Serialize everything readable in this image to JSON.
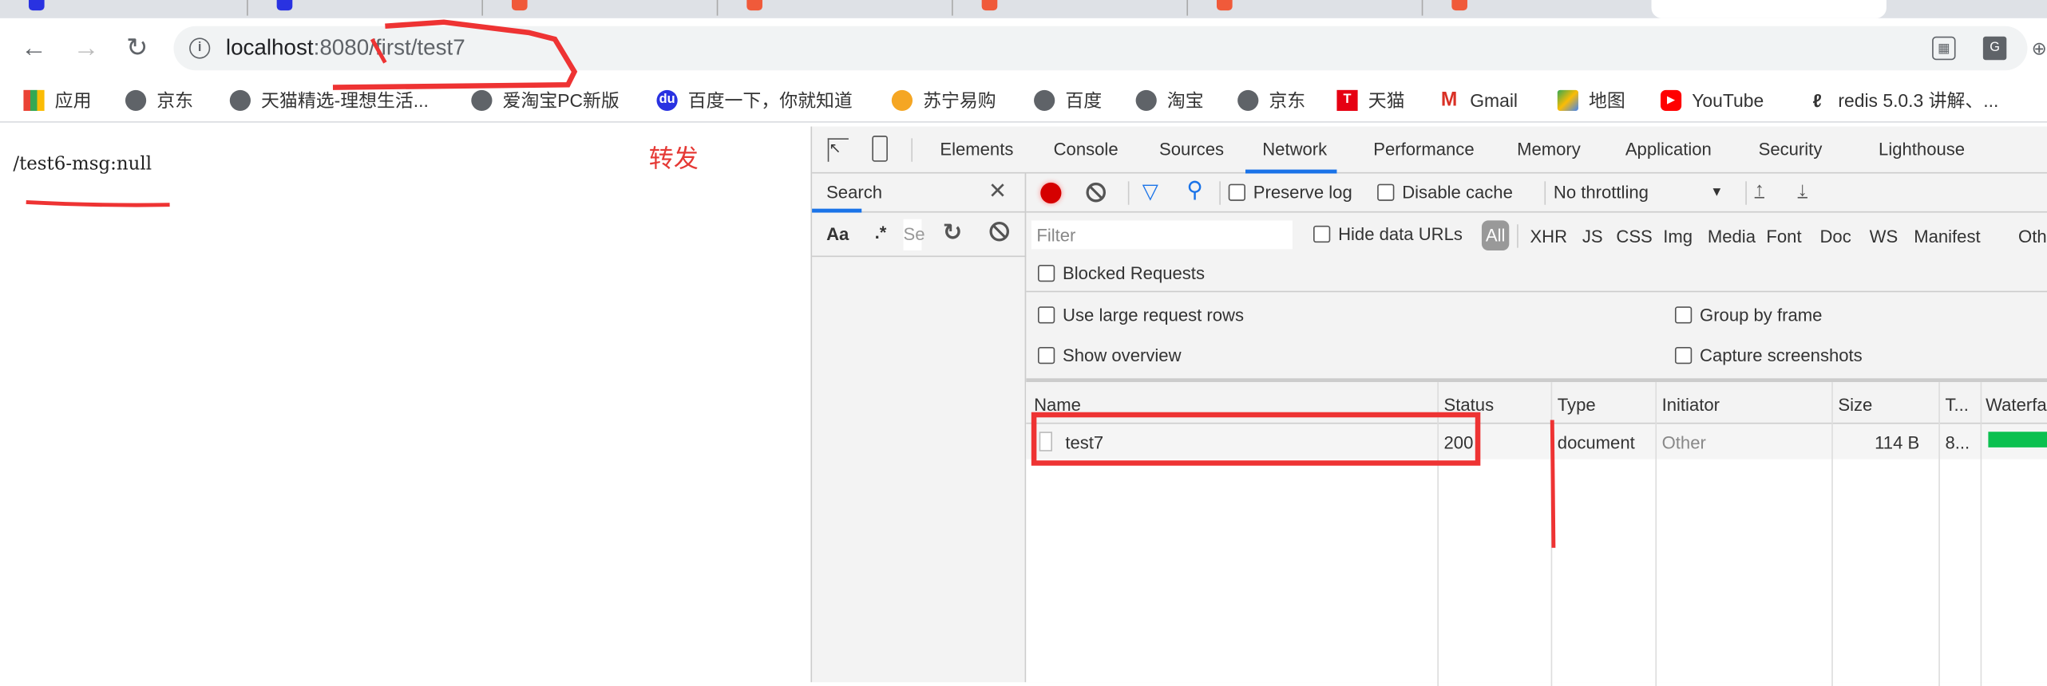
{
  "browser": {
    "url_host": "localhost",
    "url_port": ":8080",
    "url_path": "/first/test7",
    "bookmarks": [
      {
        "label": "应用",
        "icon": "apps-grid-icon"
      },
      {
        "label": "京东",
        "icon": "globe-icon"
      },
      {
        "label": "天猫精选-理想生活...",
        "icon": "globe-icon"
      },
      {
        "label": "爱淘宝PC新版",
        "icon": "globe-icon"
      },
      {
        "label": "百度一下，你就知道",
        "icon": "baidu-paw-icon"
      },
      {
        "label": "苏宁易购",
        "icon": "suning-lion-icon"
      },
      {
        "label": "百度",
        "icon": "globe-icon"
      },
      {
        "label": "淘宝",
        "icon": "globe-icon"
      },
      {
        "label": "京东",
        "icon": "globe-icon"
      },
      {
        "label": "天猫",
        "icon": "tmall-icon"
      },
      {
        "label": "Gmail",
        "icon": "gmail-icon"
      },
      {
        "label": "地图",
        "icon": "maps-icon"
      },
      {
        "label": "YouTube",
        "icon": "youtube-icon"
      },
      {
        "label": "redis 5.0.3 讲解、...",
        "icon": "bookmark-icon"
      }
    ]
  },
  "page": {
    "message": "/test6-msg:null",
    "annotation": "转发"
  },
  "devtools": {
    "tabs": [
      "Elements",
      "Console",
      "Sources",
      "Network",
      "Performance",
      "Memory",
      "Application",
      "Security",
      "Lighthouse"
    ],
    "active_tab": "Network",
    "search": {
      "title": "Search",
      "aa": "Aa",
      "regex": ".*",
      "input_placeholder": "Se"
    },
    "toolbar": {
      "preserve_log": "Preserve log",
      "disable_cache": "Disable cache",
      "throttling": "No throttling"
    },
    "filter": {
      "placeholder": "Filter",
      "hide_data_urls": "Hide data URLs",
      "types": [
        "All",
        "XHR",
        "JS",
        "CSS",
        "Img",
        "Media",
        "Font",
        "Doc",
        "WS",
        "Manifest",
        "Oth"
      ],
      "blocked": "Blocked Requests"
    },
    "settings": {
      "large_rows": "Use large request rows",
      "group_by_frame": "Group by frame",
      "show_overview": "Show overview",
      "capture_screenshots": "Capture screenshots"
    },
    "columns": [
      "Name",
      "Status",
      "Type",
      "Initiator",
      "Size",
      "T...",
      "Waterfa"
    ],
    "rows": [
      {
        "name": "test7",
        "status": "200",
        "type": "document",
        "initiator": "Other",
        "size": "114 B",
        "time": "8..."
      }
    ],
    "colors": {
      "accent": "#1a73e8",
      "record": "#d50000",
      "waterfall": "#0cc050",
      "annotation": "#e53935"
    }
  }
}
